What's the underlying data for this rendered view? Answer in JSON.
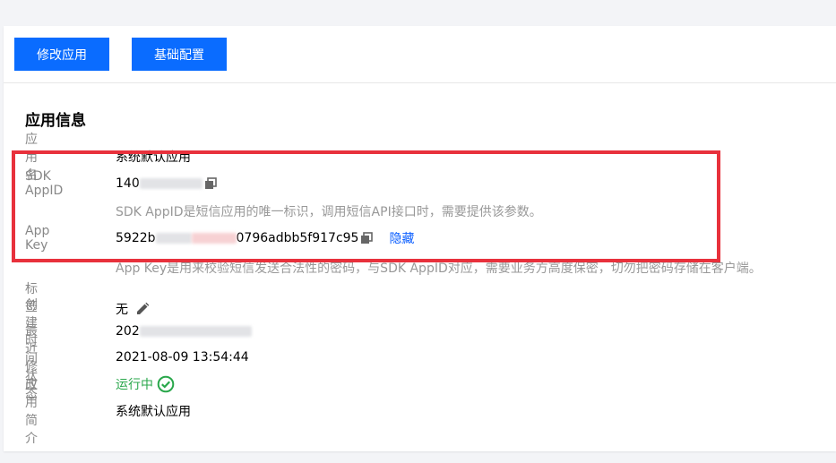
{
  "toolbar": {
    "edit_app_label": "修改应用",
    "basic_config_label": "基础配置"
  },
  "section": {
    "title": "应用信息"
  },
  "fields": {
    "app_name": {
      "label": "应用名",
      "value": "系统默认应用"
    },
    "sdk_appid": {
      "label": "SDK AppID",
      "value_prefix": "140",
      "hint": "SDK AppID是短信应用的唯一标识，调用短信API接口时，需要提供该参数。"
    },
    "app_key": {
      "label": "App Key",
      "value_prefix": "5922b",
      "value_suffix": "0796adbb5f917c95",
      "hide_link": "隐藏",
      "hint": "App Key是用来校验短信发送合法性的密码，与SDK AppID对应，需要业务方高度保密，切勿把密码存储在客户端。"
    },
    "tags": {
      "label": "标签",
      "value": "无"
    },
    "created_time": {
      "label": "创建时间",
      "value_prefix": "202"
    },
    "modified_time": {
      "label": "最近修改",
      "value": "2021-08-09 13:54:44"
    },
    "status": {
      "label": "状态",
      "value": "运行中",
      "color": "#29a74b"
    },
    "description": {
      "label": "应用简介",
      "value": "系统默认应用"
    }
  },
  "icons": {
    "copy": "copy-icon",
    "edit": "pencil-icon",
    "status_ok": "check-circle-icon"
  },
  "colors": {
    "primary": "#0a6cff",
    "highlight_box": "#e8313c"
  }
}
